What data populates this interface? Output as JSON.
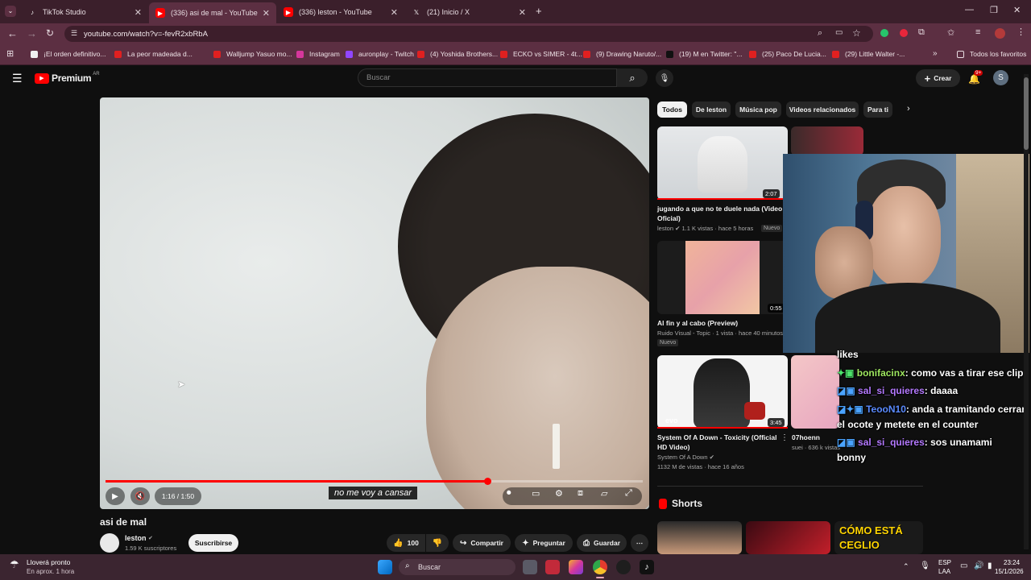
{
  "browser": {
    "tabs": [
      {
        "label": "TikTok Studio",
        "icon": "tiktok-icon"
      },
      {
        "label": "(336) asi de mal - YouTube",
        "icon": "youtube-icon"
      },
      {
        "label": "(336) leston - YouTube",
        "icon": "youtube-icon"
      },
      {
        "label": "(21) Inicio / X",
        "icon": "x-icon"
      }
    ],
    "url": "youtube.com/watch?v=-fevR2xbRbA",
    "bookmarks": [
      "¡El orden definitivo...",
      "La peor madeada d...",
      "Walljump Yasuo mo...",
      "Instagram",
      "auronplay - Twitch",
      "(4) Yoshida Brothers...",
      "ECKO vs SIMER - 4t...",
      "(9) Drawing Naruto/...",
      "(19) M en Twitter: \"...",
      "(25) Paco De Lucia...",
      "(29) Little Walter -..."
    ],
    "bookmarks_folder": "Todos los favoritos"
  },
  "youtube": {
    "logo": "Premium",
    "region": "AR",
    "search_placeholder": "Buscar",
    "create_label": "Crear",
    "notif_count": "9+",
    "avatar_letter": "S",
    "chips": [
      "Todos",
      "De leston",
      "Música pop",
      "Videos relacionados",
      "Para ti"
    ],
    "player": {
      "time": "1:16 / 1:50",
      "progress": 0.71,
      "subtitle": "no me voy a cansar"
    },
    "video": {
      "title": "asi de mal",
      "channel": "leston",
      "subs": "1.59 K suscriptores",
      "subscribe_label": "Suscribirse",
      "likes": "100",
      "share_label": "Compartir",
      "ask_label": "Preguntar",
      "save_label": "Guardar"
    },
    "related": [
      {
        "title": "jugando a que no te duele nada (Video Oficial)",
        "channel": "leston",
        "meta": "1.1 K vistas · hace 5 horas",
        "badge": "Nuevo",
        "duration": "2:07"
      },
      {
        "title": "Al fin y al cabo (Preview)",
        "channel": "Ruido Visual - Topic · 1 vista · hace 40 minutos",
        "meta": "",
        "badge": "Nuevo",
        "duration": "0:55"
      },
      {
        "title": "System Of A Down - Toxicity (Official HD Video)",
        "channel": "System Of A Down",
        "meta": "1132 M de vistas · hace 16 años",
        "badge": "",
        "duration": "3:45"
      }
    ],
    "side_extra": {
      "channel": "07hoenn",
      "meta": "suei · 636 k vistas"
    },
    "shorts_label": "Shorts",
    "short_caption": "CÓMO ESTÁ CEGLIO"
  },
  "stream_chat": [
    {
      "user": "",
      "msg": "likes"
    },
    {
      "user": "bonifacinx",
      "msg": ": como vas a tirar ese clip"
    },
    {
      "user": "sal_si_quieres",
      "msg": ": daaaa"
    },
    {
      "user": "TeooN10",
      "msg": ": anda a tramitando cerrar"
    },
    {
      "user": "",
      "msg": "el ocote y metete en el counter"
    },
    {
      "user": "sal_si_quieres",
      "msg": ": sos unamami"
    },
    {
      "user": "",
      "msg": "bonny"
    }
  ],
  "taskbar": {
    "weather": "Lloverá pronto",
    "weather_sub": "En aprox. 1 hora",
    "search": "Buscar",
    "lang": "ESP",
    "lang_sub": "LAA",
    "time": "23:24",
    "date": "15/1/2026"
  },
  "colors": {
    "accent_red": "#ff0000",
    "tab_bg": "#3b1f2b",
    "toolbar_bg": "#5c2f42"
  }
}
